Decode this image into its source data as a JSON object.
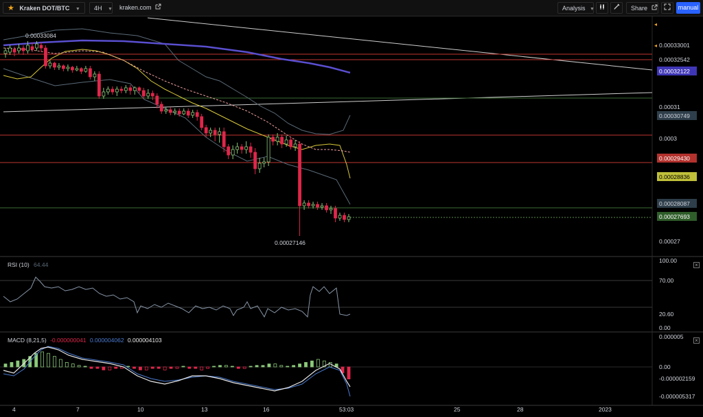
{
  "toolbar": {
    "symbol": "Kraken DOT/BTC",
    "interval": "4H",
    "source": "kraken.com",
    "analysis": "Analysis",
    "share": "Share",
    "manual": "manual"
  },
  "price_chart": {
    "high_label": "0.00033084",
    "low_label": "0.00027146",
    "axis_ticks": [
      "0.00033001",
      "0.00031",
      "0.0003",
      "0.00027"
    ],
    "tags": [
      {
        "text": "0.00032542",
        "color": "#000000",
        "text_color": "#d1d4dc"
      },
      {
        "text": "0.00032122",
        "color": "#3f36b6",
        "text_color": "#ffffff"
      },
      {
        "text": "0.00030749",
        "color": "#2e3e4a",
        "text_color": "#d1d4dc"
      },
      {
        "text": "0.00029430",
        "color": "#b3322d",
        "text_color": "#ffffff"
      },
      {
        "text": "0.00028836",
        "color": "#c0c03a",
        "text_color": "#000000"
      },
      {
        "text": "0.00028087",
        "color": "#2e3e4a",
        "text_color": "#d1d4dc"
      },
      {
        "text": "0.00027693",
        "color": "#2f5e2a",
        "text_color": "#ffffff"
      }
    ]
  },
  "rsi": {
    "title": "RSI (10)",
    "value": "64.44",
    "ticks": [
      "100.00",
      "70.00",
      "20.60",
      "0.00"
    ]
  },
  "macd": {
    "title": "MACD (8,21,5)",
    "hist": "-0.000000041",
    "signal": "0.000004062",
    "macd": "0.000004103",
    "ticks": [
      "0.000005",
      "0.00",
      "-0.000002159",
      "-0.000005317"
    ]
  },
  "time_axis": [
    "4",
    "7",
    "10",
    "13",
    "16",
    "53:03",
    "25",
    "28",
    "2023"
  ],
  "colors": {
    "up": "#8bc97a",
    "down": "#e0264a",
    "ma_purple": "#5a4fd0",
    "ma_yellow": "#d9c83a",
    "ma_dash": "#f0a0a0",
    "boll": "#5b6b78",
    "hline_red": "#c0362f",
    "hline_green": "#3d6b34"
  },
  "icons": [
    "star-icon",
    "external-link-icon",
    "indicators-icon",
    "pencil-icon",
    "share-icon",
    "fullscreen-icon",
    "close-icon"
  ]
}
